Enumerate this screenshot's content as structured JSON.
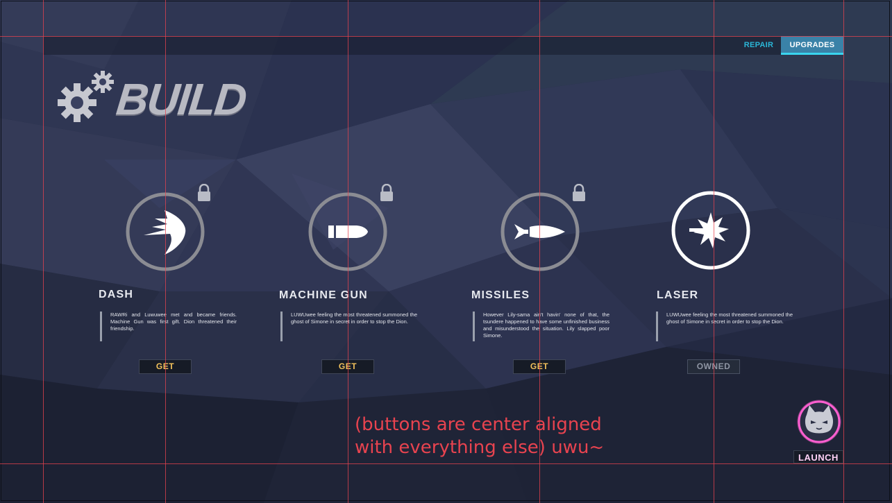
{
  "nav": {
    "tabs": [
      {
        "label": "REPAIR",
        "active": false
      },
      {
        "label": "UPGRADES",
        "active": true
      }
    ]
  },
  "header": {
    "title": "BUILD",
    "icon": "gears-icon"
  },
  "items": [
    {
      "name": "DASH",
      "icon": "dash-icon",
      "locked": true,
      "description": "RAWRi and Luwuwee met and became friends. Machine Gun was first gift. Dion threatened their friendship.",
      "button": "GET",
      "owned": false
    },
    {
      "name": "MACHINE GUN",
      "icon": "bullet-icon",
      "locked": true,
      "description": "LUWUwee feeling the most threatened summoned the ghost of Simone in secret in order to stop the Dion.",
      "button": "GET",
      "owned": false
    },
    {
      "name": "MISSILES",
      "icon": "missile-icon",
      "locked": true,
      "description": "However Lily-sama ain't havin' none of that, the tsundere happened to have some unfinished business and misunderstood the situation. Lily slapped poor Simone.",
      "button": "GET",
      "owned": false
    },
    {
      "name": "LASER",
      "icon": "laser-icon",
      "locked": false,
      "description": "LUWUwee feeling the most threatened summoned the ghost of Simone in secret in order to stop the Dion.",
      "button": "OWNED",
      "owned": true
    }
  ],
  "annotation": {
    "line1": "(buttons are center aligned",
    "line2": "with everything else) uwu~"
  },
  "launch": {
    "label": "LAUNCH",
    "icon": "cat-face-icon"
  },
  "colors": {
    "accent_cyan": "#2bb7d8",
    "tab_active": "#3a82a8",
    "get_text": "#f1c15b",
    "annotation_red": "#e8434f",
    "launch_pink": "#ff5fd1"
  }
}
